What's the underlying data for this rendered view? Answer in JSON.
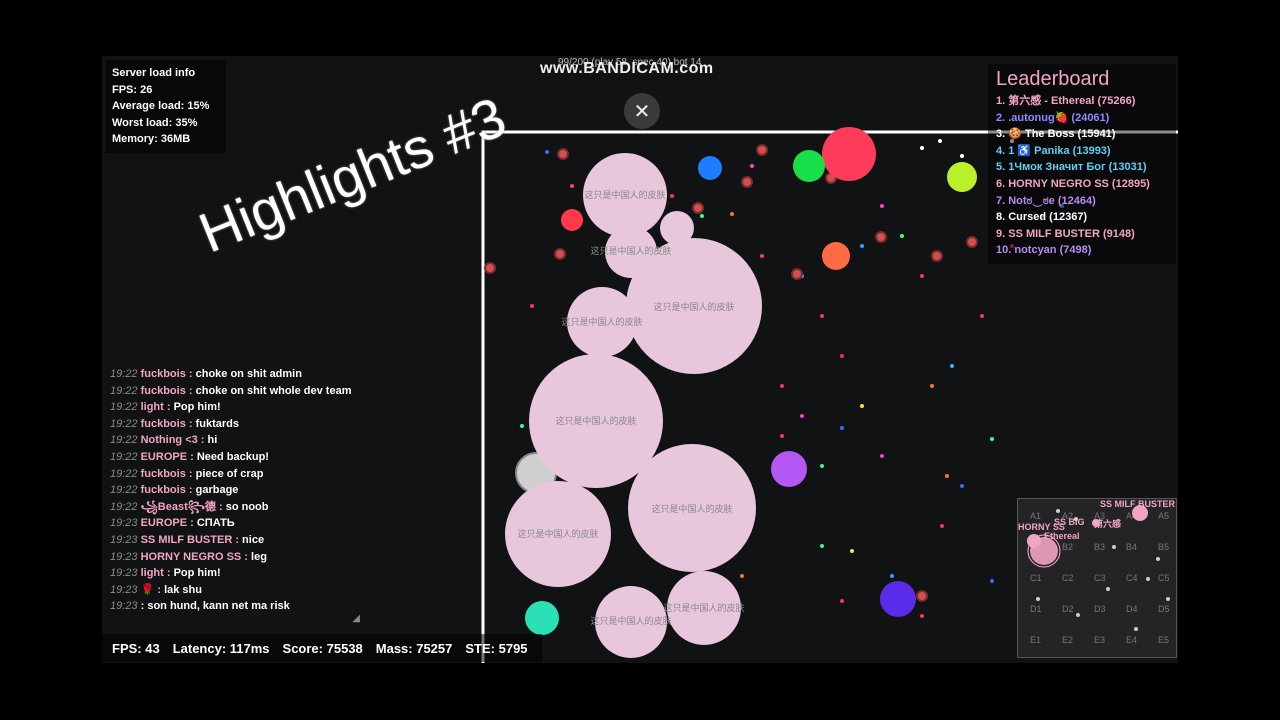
{
  "server_info": {
    "title": "Server load info",
    "fps": "FPS: 26",
    "average_load": "Average load: 15%",
    "worst_load": "Worst load: 35%",
    "memory": "Memory: 36MB"
  },
  "watermark": "www.BANDICAM.com",
  "watermark_under": "99/200 (play 58, spec 40) bot 14",
  "close_icon": "close-icon",
  "overlay_title": "Highlights #3",
  "leaderboard": {
    "title": "Leaderboard",
    "rows": [
      {
        "text": "1. 第六感 - Ethereal (75266)",
        "color": "#f2a4c4"
      },
      {
        "text": "2. .autonug🍓 (24061)",
        "color": "#8a8cff"
      },
      {
        "text": "3. 🍪 The Boss (15941)",
        "color": "#ffffff"
      },
      {
        "text": "4. 1 ♿            Panika (13993)",
        "color": "#5fd0f0"
      },
      {
        "text": "5. 1Чмок Значит Бог (13031)",
        "color": "#5fd0f0"
      },
      {
        "text": "6. HORNY NEGRO SS (12895)",
        "color": "#f2a4c4"
      },
      {
        "text": "7. Notಠ‿ಠe (12464)",
        "color": "#b78af0"
      },
      {
        "text": "8. Cursed (12367)",
        "color": "#ffffff"
      },
      {
        "text": "9. SS MILF BUSTER (9148)",
        "color": "#f2a4c4"
      },
      {
        "text": "10. notcyan (7498)",
        "color": "#b78af0"
      }
    ]
  },
  "chat": [
    {
      "time": "19:22",
      "name": "fuckbois :",
      "name_color": "#f2a4c4",
      "msg": "choke on shit admin"
    },
    {
      "time": "19:22",
      "name": "fuckbois :",
      "name_color": "#f2a4c4",
      "msg": "choke on shit whole dev team"
    },
    {
      "time": "19:22",
      "name": "light :",
      "name_color": "#f2a4c4",
      "msg": "Pop him!"
    },
    {
      "time": "19:22",
      "name": "fuckbois :",
      "name_color": "#f2a4c4",
      "msg": "fuktards"
    },
    {
      "time": "19:22",
      "name": "Nothing <3 :",
      "name_color": "#f2a4c4",
      "msg": "hi"
    },
    {
      "time": "19:22",
      "name": "EUROPE :",
      "name_color": "#f2a4c4",
      "msg": "Need backup!"
    },
    {
      "time": "19:22",
      "name": "fuckbois :",
      "name_color": "#f2a4c4",
      "msg": "piece of crap"
    },
    {
      "time": "19:22",
      "name": "fuckbois :",
      "name_color": "#f2a4c4",
      "msg": "garbage"
    },
    {
      "time": "19:22",
      "name": "꧁Beast꧂德 :",
      "name_color": "#f2a4c4",
      "msg": "so noob"
    },
    {
      "time": "19:23",
      "name": "EUROPE :",
      "name_color": "#f2a4c4",
      "msg": "СПАТЬ"
    },
    {
      "time": "19:23",
      "name": "SS MILF BUSTER :",
      "name_color": "#f2a4c4",
      "msg": "nice"
    },
    {
      "time": "19:23",
      "name": "HORNY NEGRO SS :",
      "name_color": "#f2a4c4",
      "msg": "leg"
    },
    {
      "time": "19:23",
      "name": "light :",
      "name_color": "#f2a4c4",
      "msg": "Pop him!"
    },
    {
      "time": "19:23",
      "name": "🌹 :",
      "name_color": "#f2a4c4",
      "msg": "lak shu"
    },
    {
      "time": "19:23",
      "name": ":",
      "name_color": "#ffffff",
      "msg": "son hund, kann net ma risk"
    }
  ],
  "status": {
    "fps": "FPS: 43",
    "latency": "Latency: 117ms",
    "score": "Score: 75538",
    "mass": "Mass: 75257",
    "ste": "STE: 5795"
  },
  "cell_text": "这只是中国人的皮肤",
  "cell_text_small": "这只是中国人的皮肤",
  "minimap": {
    "grid_rows": [
      [
        "A1",
        "A2",
        "A3",
        "A4",
        "A5"
      ],
      [
        "B1",
        "B2",
        "B3",
        "B4",
        "B5"
      ],
      [
        "C1",
        "C2",
        "C3",
        "C4",
        "C5"
      ],
      [
        "D1",
        "D2",
        "D3",
        "D4",
        "D5"
      ],
      [
        "E1",
        "E2",
        "E3",
        "E4",
        "E5"
      ]
    ],
    "labels": [
      "SS MILF BUSTER",
      "SS BIG",
      "第六感",
      "HORNY SS",
      "Ethereal"
    ]
  },
  "colors": {
    "player_cell": "#e8c7dc",
    "border": "#ffffff",
    "accent_pink": "#f2a4c4"
  }
}
